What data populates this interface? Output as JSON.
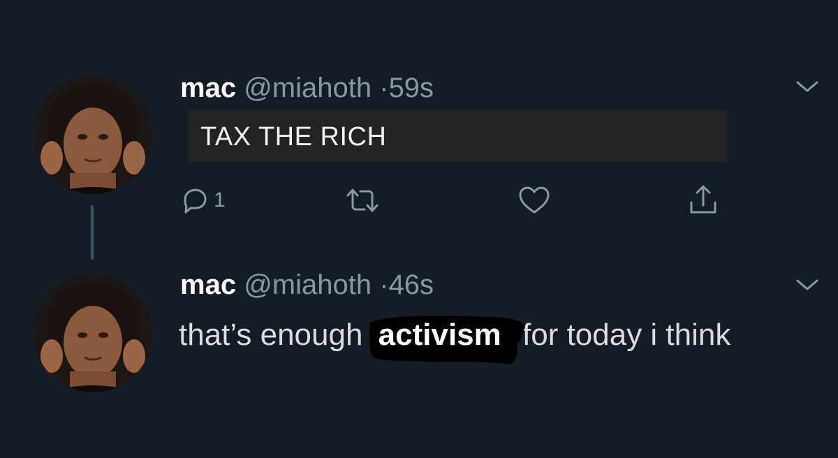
{
  "tweets": [
    {
      "name": "mac",
      "handle": "@miahoth",
      "separator": "·",
      "time": "59s",
      "text": "TAX THE RICH",
      "actions": {
        "reply_count": "1",
        "icons": [
          "reply-icon",
          "retweet-icon",
          "like-icon",
          "share-icon"
        ]
      }
    },
    {
      "name": "mac",
      "handle": "@miahoth",
      "separator": "·",
      "time": "46s",
      "text_before": "that’s enough",
      "text_highlight": "activism",
      "text_after": "for today i think"
    }
  ],
  "colors": {
    "background": "#141d26",
    "muted": "#8899a6",
    "text": "#ffffff",
    "caption_box": "#222325",
    "thread_line": "#3d5466"
  }
}
